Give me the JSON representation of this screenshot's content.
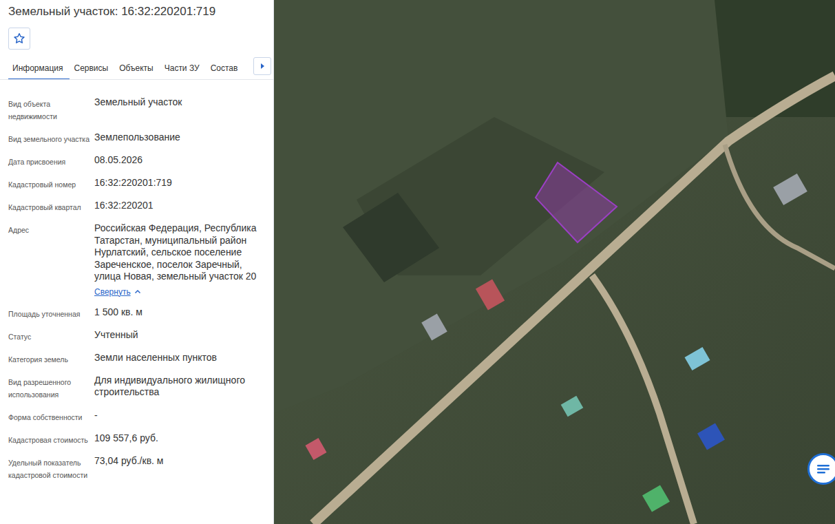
{
  "header": {
    "title": "Земельный участок: 16:32:220201:719"
  },
  "favorite": {
    "selected": false
  },
  "tabs": [
    {
      "label": "Информация",
      "selected": true
    },
    {
      "label": "Сервисы",
      "selected": false
    },
    {
      "label": "Объекты",
      "selected": false
    },
    {
      "label": "Части ЗУ",
      "selected": false
    },
    {
      "label": "Состав",
      "selected": false
    }
  ],
  "fields": [
    {
      "label": "Вид объекта недвижимости",
      "value": "Земельный участок"
    },
    {
      "label": "Вид земельного участка",
      "value": "Землепользование"
    },
    {
      "label": "Дата присвоения",
      "value": "08.05.2026"
    },
    {
      "label": "Кадастровый номер",
      "value": "16:32:220201:719"
    },
    {
      "label": "Кадастровый квартал",
      "value": "16:32:220201"
    },
    {
      "label": "Адрес",
      "value": "Российская Федерация, Республика Татарстан, муниципальный район Нурлатский, сельское поселение Зареченское, поселок Заречный, улица Новая, земельный участок 20",
      "link": "Свернуть",
      "expanded": true
    },
    {
      "label": "Площадь уточненная",
      "value": "1 500 кв. м"
    },
    {
      "label": "Статус",
      "value": "Учтенный"
    },
    {
      "label": "Категория земель",
      "value": "Земли населенных пунктов"
    },
    {
      "label": "Вид разрешенного использования",
      "value": "Для индивидуального жилищного строительства"
    },
    {
      "label": "Форма собственности",
      "value": "-"
    },
    {
      "label": "Кадастровая стоимость",
      "value": "109 557,6 руб."
    },
    {
      "label": "Удельный показатель кадастровой стоимости",
      "value": "73,04 руб./кв. м"
    }
  ]
}
